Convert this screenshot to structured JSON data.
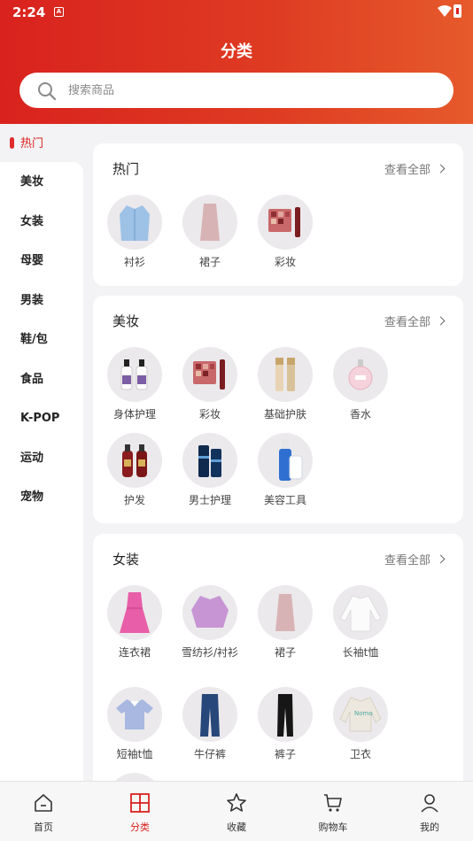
{
  "status": {
    "time": "2:24",
    "a_badge": "A"
  },
  "header": {
    "title": "分类"
  },
  "search": {
    "placeholder": "搜索商品"
  },
  "sidebar": {
    "items": [
      {
        "label": "热门",
        "active": true
      },
      {
        "label": "美妆"
      },
      {
        "label": "女装"
      },
      {
        "label": "母婴"
      },
      {
        "label": "男装"
      },
      {
        "label": "鞋/包"
      },
      {
        "label": "食品"
      },
      {
        "label": "K-POP"
      },
      {
        "label": "运动"
      },
      {
        "label": "宠物"
      }
    ]
  },
  "sections": [
    {
      "title": "热门",
      "more": "查看全部",
      "items": [
        "衬衫",
        "裙子",
        "彩妆"
      ]
    },
    {
      "title": "美妆",
      "more": "查看全部",
      "items": [
        "身体护理",
        "彩妆",
        "基础护肤",
        "香水",
        "护发",
        "男士护理",
        "美容工具"
      ]
    },
    {
      "title": "女装",
      "more": "查看全部",
      "items": [
        "连衣裙",
        "雪纺衫/衬衫",
        "裙子",
        "长袖t恤",
        "短袖t恤",
        "牛仔裤",
        "裤子",
        "卫衣"
      ]
    }
  ],
  "bottom_nav": [
    {
      "label": "首页",
      "icon": "home-icon"
    },
    {
      "label": "分类",
      "icon": "category-icon",
      "active": true
    },
    {
      "label": "收藏",
      "icon": "star-icon"
    },
    {
      "label": "购物车",
      "icon": "cart-icon"
    },
    {
      "label": "我的",
      "icon": "user-icon"
    }
  ],
  "colors": {
    "accent": "#d9221e",
    "header_end": "#e65a2b"
  }
}
